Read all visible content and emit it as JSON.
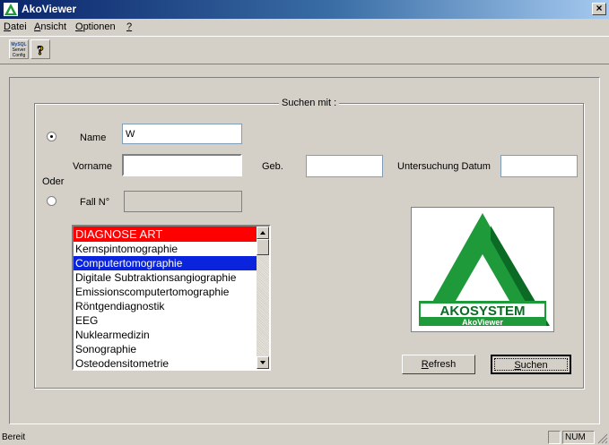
{
  "window": {
    "title": "AkoViewer",
    "close_label": "×"
  },
  "menu": {
    "items": [
      {
        "pre": "D",
        "rest": "atei"
      },
      {
        "pre": "A",
        "rest": "nsicht"
      },
      {
        "pre": "O",
        "rest": "ptionen"
      },
      {
        "pre": "?",
        "rest": ""
      }
    ]
  },
  "toolbar": {
    "mysql_line1": "MySQL",
    "mysql_line2": "Server",
    "mysql_line3": "Config",
    "help_glyph": "?"
  },
  "search": {
    "group_title": "Suchen mit :",
    "name_label": "Name",
    "name_value": "W",
    "vorname_label": "Vorname",
    "vorname_value": "",
    "geb_label": "Geb.",
    "geb_value": "",
    "untersuchung_label": "Untersuchung Datum",
    "untersuchung_value": "",
    "oder_label": "Oder",
    "fall_label": "Fall N°",
    "fall_value": "",
    "mode": "name"
  },
  "diagnose": {
    "header": "DIAGNOSE ART",
    "items": [
      "Kernspintomographie",
      "Computertomographie",
      "Digitale Subtraktionsangiographie",
      "Emissionscomputertomographie",
      "Röntgendiagnostik",
      "EEG",
      "Nuklearmedizin",
      "Sonographie",
      "Osteodensitometrie"
    ],
    "selected_index": 1
  },
  "logo": {
    "brand": "AKOSYSTEM",
    "product": "AkoViewer",
    "colors": {
      "green": "#1f9a3a",
      "dark_green": "#0b6b25"
    }
  },
  "buttons": {
    "refresh_pre": "R",
    "refresh_rest": "efresh",
    "suchen_pre": "S",
    "suchen_rest": "uchen"
  },
  "status": {
    "text": "Bereit",
    "num": "NUM"
  }
}
